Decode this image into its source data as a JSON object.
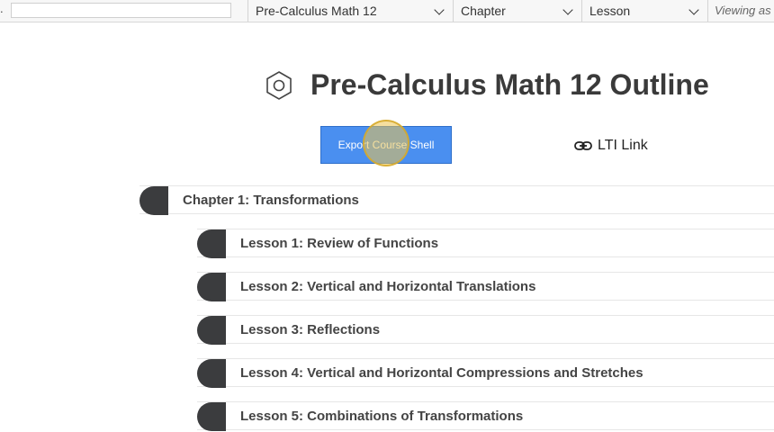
{
  "toolbar": {
    "course_select": "Pre-Calculus Math 12",
    "chapter_select": "Chapter",
    "lesson_select": "Lesson",
    "viewing_as": "Viewing as"
  },
  "page": {
    "title": "Pre-Calculus Math 12 Outline",
    "title_icon": "hexagon-icon"
  },
  "actions": {
    "export_label": "Export Course Shell",
    "lti_label": "LTI Link",
    "lti_icon": "link-icon",
    "export_color": "#4a8ff0"
  },
  "outline": {
    "chapter": "Chapter 1: Transformations",
    "lessons": [
      "Lesson 1: Review of Functions",
      "Lesson 2: Vertical and Horizontal Translations",
      "Lesson 3: Reflections",
      "Lesson 4: Vertical and Horizontal Compressions and Stretches",
      "Lesson 5: Combinations of Transformations"
    ]
  }
}
